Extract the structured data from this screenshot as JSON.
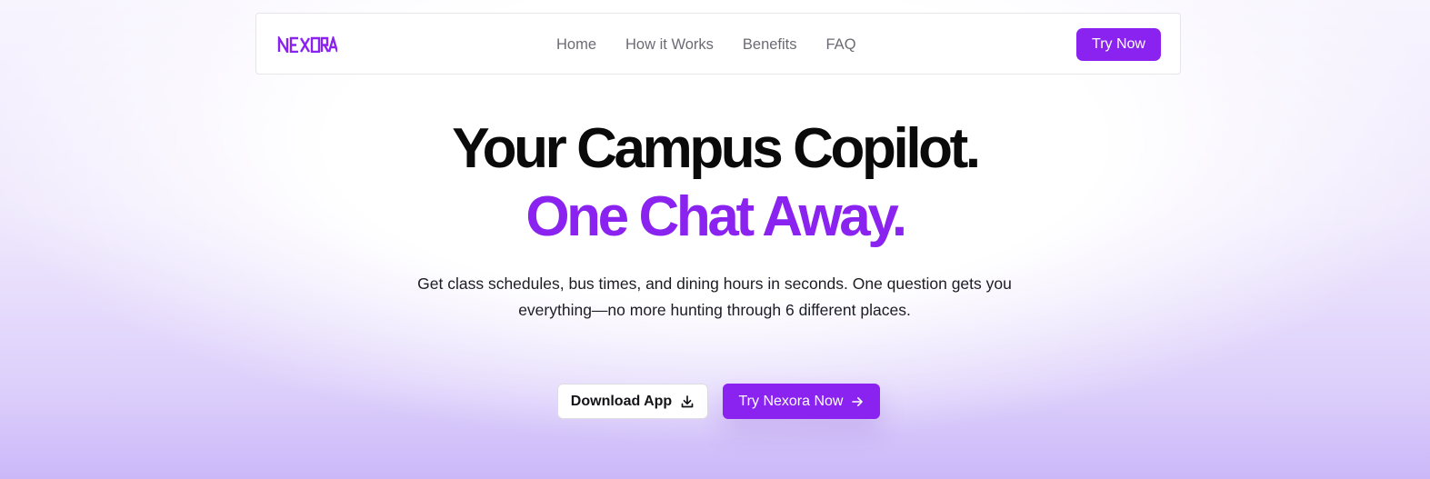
{
  "brand": {
    "logo_text": "NEXORA",
    "accent_color": "#8a23f0"
  },
  "nav": {
    "links": [
      "Home",
      "How it Works",
      "Benefits",
      "FAQ"
    ],
    "cta_label": "Try Now"
  },
  "hero": {
    "headline_line1": "Your Campus Copilot.",
    "headline_line2": "One Chat Away.",
    "subtitle_line1": "Get class schedules, bus times, and dining hours in seconds. One question gets you",
    "subtitle_line2": "everything—no more hunting through 6 different places.",
    "download_button": {
      "label": "Download App",
      "icon": "download-icon"
    },
    "try_button": {
      "label": "Try Nexora Now",
      "icon": "arrow-right-icon"
    }
  }
}
